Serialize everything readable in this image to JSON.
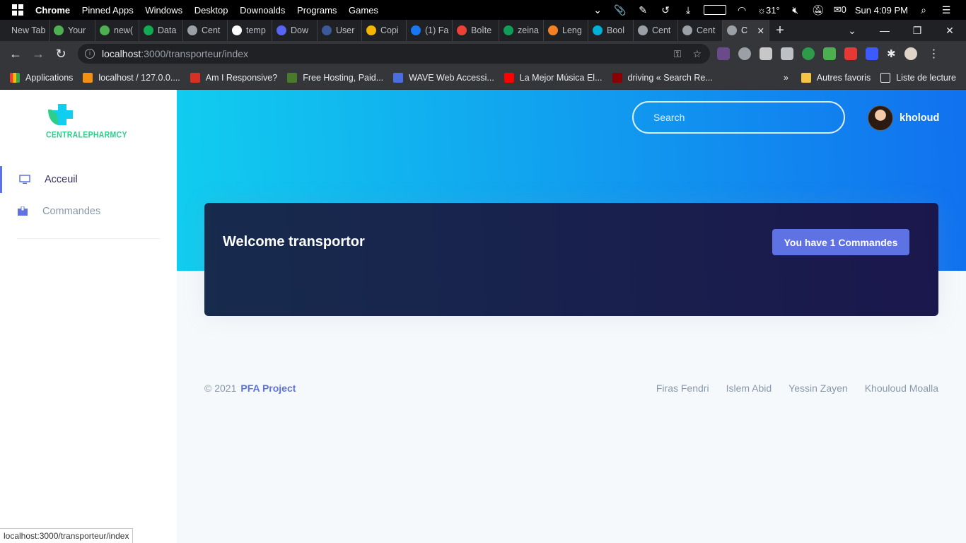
{
  "os_taskbar": {
    "menu": [
      "Chrome",
      "Pinned Apps",
      "Windows",
      "Desktop",
      "Downoalds",
      "Programs",
      "Games"
    ],
    "weather": "31°",
    "mail_count": "0",
    "clock": "Sun 4:09 PM"
  },
  "browser": {
    "tabs": [
      {
        "label": "New Tab",
        "color": "#202124"
      },
      {
        "label": "Your",
        "color": "#4caf50"
      },
      {
        "label": "new(",
        "color": "#4caf50"
      },
      {
        "label": "Data",
        "color": "#13aa52"
      },
      {
        "label": "Cent",
        "color": "#9aa0a6"
      },
      {
        "label": "temp",
        "color": "#ffffff"
      },
      {
        "label": "Dow",
        "color": "#5865f2"
      },
      {
        "label": "User",
        "color": "#3b5998"
      },
      {
        "label": "Copi",
        "color": "#f4b400"
      },
      {
        "label": "(1) Fa",
        "color": "#1877f2"
      },
      {
        "label": "Boîte",
        "color": "#ea4335"
      },
      {
        "label": "zeina",
        "color": "#0f9d58"
      },
      {
        "label": "Leng",
        "color": "#f48024"
      },
      {
        "label": "Bool",
        "color": "#00b0d7"
      },
      {
        "label": "Cent",
        "color": "#9aa0a6"
      },
      {
        "label": "Cent",
        "color": "#9aa0a6"
      },
      {
        "label": "C",
        "color": "#9aa0a6"
      }
    ],
    "url_host": "localhost",
    "url_path": ":3000/transporteur/index",
    "bookmarks": [
      {
        "label": "Applications",
        "color": "#ea4335"
      },
      {
        "label": "localhost / 127.0.0....",
        "color": "#f29111"
      },
      {
        "label": "Am I Responsive?",
        "color": "#d93025"
      },
      {
        "label": "Free Hosting, Paid...",
        "color": "#4a7a2c"
      },
      {
        "label": "WAVE Web Accessi...",
        "color": "#4a6ee0"
      },
      {
        "label": "La Mejor Música El...",
        "color": "#ff0000"
      },
      {
        "label": "driving « Search Re...",
        "color": "#8b0000"
      }
    ],
    "bookmarks_more": "»",
    "other_bookmarks": "Autres favoris",
    "reading_list": "Liste de lecture",
    "status_url": "localhost:3000/transporteur/index"
  },
  "sidebar": {
    "logo_text": "CENTRALEPHARMCY",
    "items": [
      {
        "label": "Acceuil",
        "icon": "monitor-icon",
        "active": true
      },
      {
        "label": "Commandes",
        "icon": "box-icon",
        "active": false
      }
    ]
  },
  "header": {
    "search_placeholder": "Search",
    "user_name": "kholoud"
  },
  "welcome_card": {
    "title": "Welcome transportor",
    "button_label": "You have 1 Commandes"
  },
  "footer": {
    "copyright": "© 2021",
    "brand": "PFA Project",
    "links": [
      "Firas Fendri",
      "Islem Abid",
      "Yessin Zayen",
      "Khouloud Moalla"
    ]
  },
  "colors": {
    "header_gradient_start": "#11cdef",
    "header_gradient_end": "#1171ef",
    "card_bg": "#172b4d",
    "primary": "#5e72e4",
    "logo_green": "#2dce89"
  }
}
